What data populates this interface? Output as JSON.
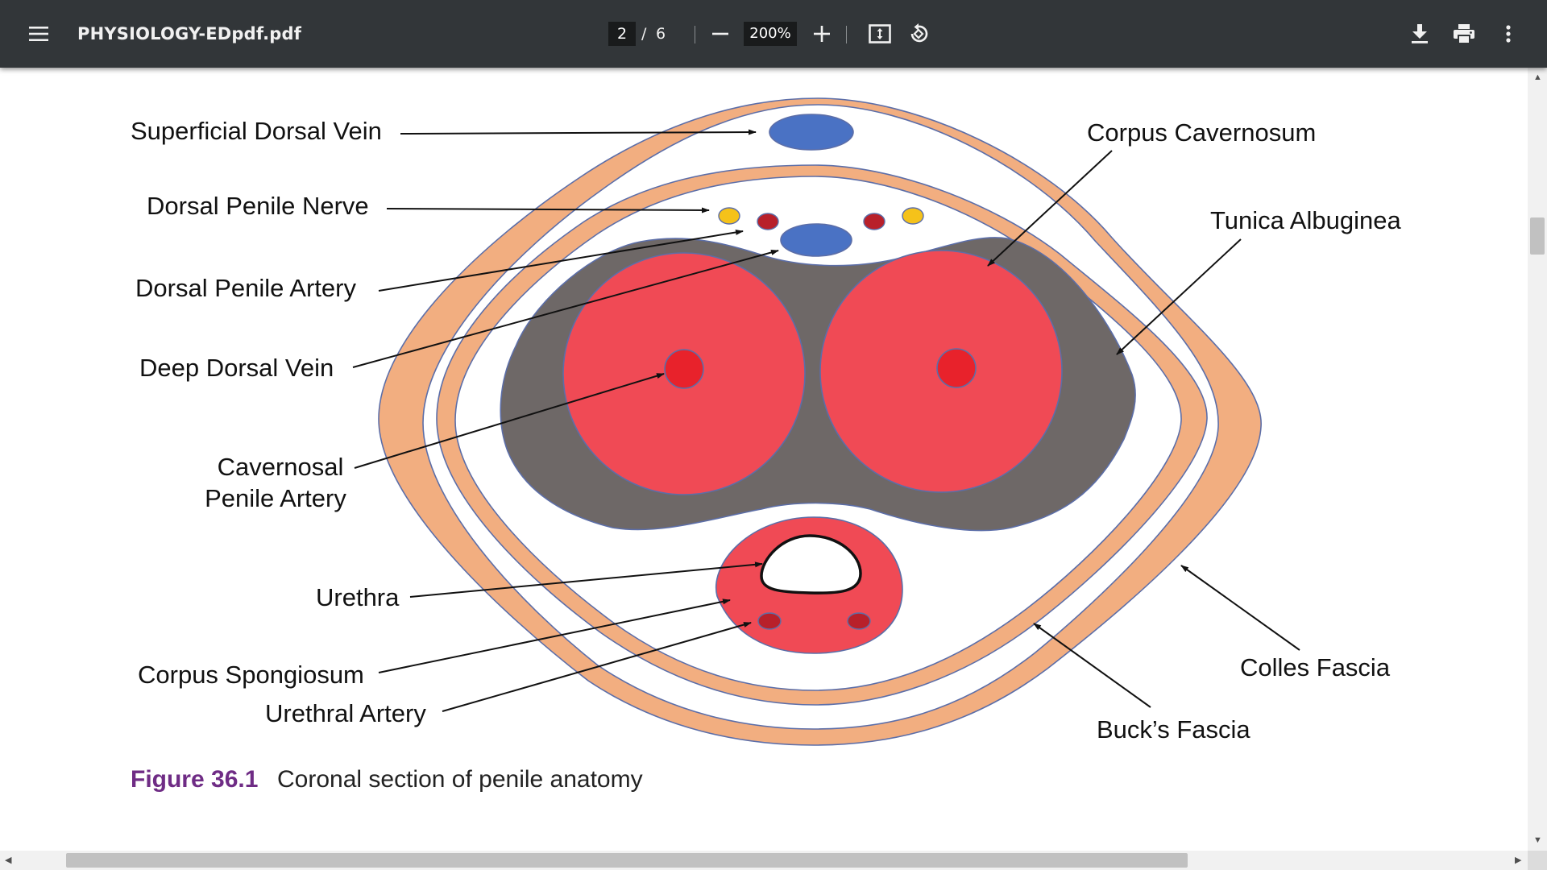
{
  "toolbar": {
    "menu_icon": "hamburger-menu-icon",
    "file_name": "PHYSIOLOGY-EDpdf.pdf",
    "current_page": "2",
    "page_separator": "/",
    "total_pages": "6",
    "zoom_out_icon": "minus-icon",
    "zoom_level": "200%",
    "zoom_in_icon": "plus-icon",
    "fit_icon": "fit-to-page-icon",
    "rotate_icon": "rotate-counterclockwise-icon",
    "download_icon": "download-icon",
    "print_icon": "print-icon",
    "more_icon": "more-vertical-icon"
  },
  "figure": {
    "labels": {
      "superficial_dorsal_vein": "Superficial Dorsal Vein",
      "dorsal_penile_nerve": "Dorsal Penile Nerve",
      "dorsal_penile_artery": "Dorsal Penile Artery",
      "deep_dorsal_vein": "Deep Dorsal Vein",
      "cavernosal_line1": "Cavernosal",
      "cavernosal_line2": "Penile Artery",
      "urethra": "Urethra",
      "corpus_spongiosum": "Corpus Spongiosum",
      "urethral_artery": "Urethral Artery",
      "corpus_cavernosum": "Corpus Cavernosum",
      "tunica_albuginea": "Tunica Albuginea",
      "colles_fascia": "Colles Fascia",
      "bucks_fascia": "Buck’s Fascia"
    },
    "caption_number": "Figure 36.1",
    "caption_text": "Coronal section of penile anatomy",
    "colors": {
      "fascia": "#f2ae80",
      "tunica": "#6e6867",
      "cavernosum": "#f04a55",
      "artery_dot": "#e8222b",
      "vein": "#4a72c4",
      "nerve": "#f5c21a",
      "small_artery": "#b8202a",
      "caption_accent": "#6f2c85"
    }
  }
}
